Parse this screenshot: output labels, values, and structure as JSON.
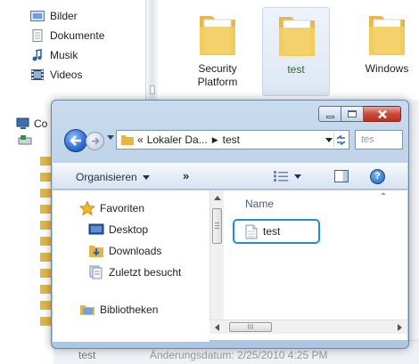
{
  "background": {
    "nav_items": [
      {
        "label": "Bilder",
        "icon": "pictures-icon"
      },
      {
        "label": "Dokumente",
        "icon": "documents-icon"
      },
      {
        "label": "Musik",
        "icon": "music-icon"
      },
      {
        "label": "Videos",
        "icon": "videos-icon"
      }
    ],
    "computer_label": "Co",
    "folders": [
      {
        "label": "Security Platform"
      },
      {
        "label": "test"
      },
      {
        "label": "Windows"
      }
    ],
    "bottom_name": "test",
    "bottom_detail": "Änderungsdatum: 2/25/2010 4:25 PM"
  },
  "dialog": {
    "address": {
      "segments": [
        "Lokaler Da...",
        "test"
      ],
      "search_placeholder": "tes"
    },
    "toolbar": {
      "organize_label": "Organisieren",
      "more_label": "»",
      "help_label": "?"
    },
    "nav": {
      "favorites_label": "Favoriten",
      "items": [
        {
          "label": "Desktop",
          "icon": "desktop-icon"
        },
        {
          "label": "Downloads",
          "icon": "downloads-icon"
        },
        {
          "label": "Zuletzt besucht",
          "icon": "recent-places-icon"
        }
      ],
      "libraries_label": "Bibliotheken"
    },
    "files": {
      "column_name": "Name",
      "items": [
        {
          "label": "test",
          "icon": "file-icon"
        }
      ]
    },
    "hscroll_thumb": "III"
  },
  "colors": {
    "selection_outline": "#1f8fcf",
    "close_button": "#c9493a",
    "window_frame": "#b9cfe7"
  }
}
